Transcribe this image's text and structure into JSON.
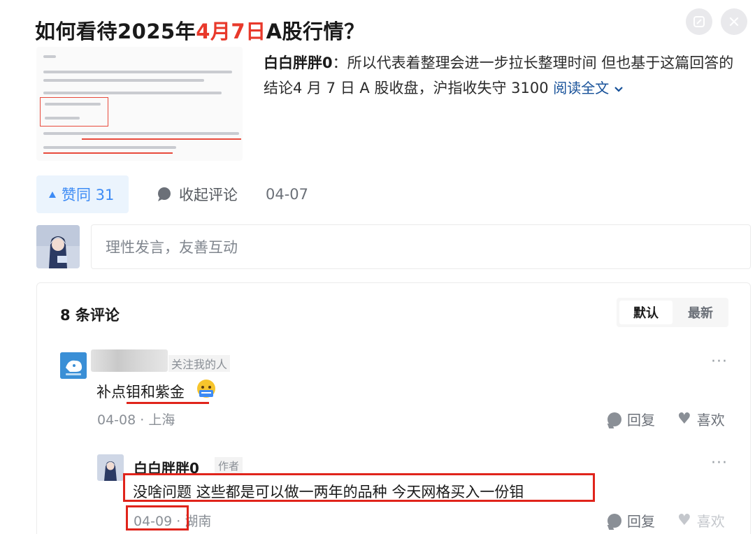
{
  "question": {
    "title_prefix": "如何看待2025年",
    "title_date": "4月7日",
    "title_suffix": "A股行情？"
  },
  "top_icons": [
    "report-icon",
    "close-icon"
  ],
  "answer": {
    "author": "白白胖胖0",
    "excerpt": "：所以代表着整理会进一步拉长整理时间 但也基于这篇回答的结论4 月 7 日 A 股收盘，沪指收失守 3100 ",
    "read_more": "阅读全文",
    "upvote_label": "赞同 31",
    "collapse_label": "收起评论",
    "date": "04-07"
  },
  "comment_input": {
    "placeholder": "理性发言，友善互动"
  },
  "comments_section": {
    "count_label": "8 条评论",
    "sort_default": "默认",
    "sort_latest": "最新"
  },
  "comments": [
    {
      "tag": "关注我的人",
      "text": "补点钼和紫金",
      "date": "04-08",
      "location": "上海",
      "reply_label": "回复",
      "like_label": "喜欢"
    },
    {
      "author": "白白胖胖0",
      "tag": "作者",
      "text": "没啥问题 这些都是可以做一两年的品种 今天网格买入一份钼",
      "date": "04-09",
      "location": "湖南",
      "reply_label": "回复",
      "like_label": "喜欢"
    }
  ],
  "colors": {
    "accent_blue": "#3d8bf5",
    "upvote_bg": "#ebf4fd",
    "highlight_red": "#e8392b",
    "annotation_red": "#e0241b",
    "link_blue": "#175199"
  }
}
